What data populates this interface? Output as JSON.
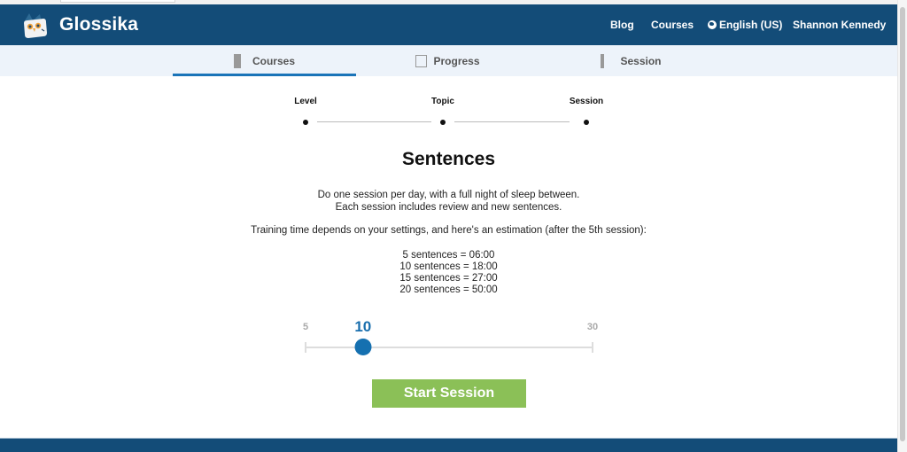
{
  "header": {
    "brand": "Glossika",
    "nav": {
      "blog": "Blog",
      "courses": "Courses",
      "language": "English (US)",
      "user": "Shannon Kennedy"
    }
  },
  "tabs": [
    {
      "label": "Courses",
      "icon": "grid-icon",
      "active": true
    },
    {
      "label": "Progress",
      "icon": "square-icon",
      "active": false
    },
    {
      "label": "Session",
      "icon": "rows-icon",
      "active": false
    }
  ],
  "steps": [
    "Level",
    "Topic",
    "Session"
  ],
  "main": {
    "title": "Sentences",
    "intro_line1": "Do one session per day, with a full night of sleep between.",
    "intro_line2": "Each session includes review and new sentences.",
    "estimate_intro": "Training time depends on your settings, and here's an estimation (after the 5th session):",
    "estimates": [
      "5 sentences = 06:00",
      "10 sentences = 18:00",
      "15 sentences = 27:00",
      "20 sentences = 50:00"
    ]
  },
  "slider": {
    "min": 5,
    "max": 30,
    "value": 10,
    "min_label": "5",
    "max_label": "30",
    "value_label": "10"
  },
  "start_button": "Start Session",
  "colors": {
    "header_bg": "#134c78",
    "accent": "#1570b0",
    "start_button": "#8bc057"
  }
}
